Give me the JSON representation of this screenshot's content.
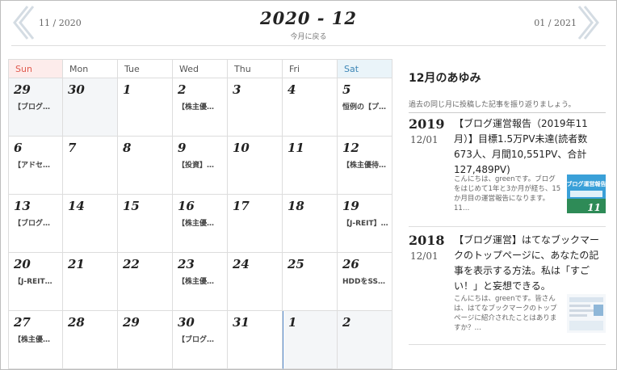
{
  "header": {
    "prev_month": "11 / 2020",
    "current_month": "2020 - 12",
    "today_link": "今月に戻る",
    "next_month": "01 / 2021"
  },
  "calendar": {
    "weekdays": [
      "Sun",
      "Mon",
      "Tue",
      "Wed",
      "Thu",
      "Fri",
      "Sat"
    ],
    "weeks": [
      [
        {
          "day": "29",
          "event": "【ブログ…",
          "other": true
        },
        {
          "day": "30",
          "event": "",
          "other": true
        },
        {
          "day": "1",
          "event": ""
        },
        {
          "day": "2",
          "event": "【株主優…"
        },
        {
          "day": "3",
          "event": ""
        },
        {
          "day": "4",
          "event": ""
        },
        {
          "day": "5",
          "event": "恒例の【プ…"
        }
      ],
      [
        {
          "day": "6",
          "event": "【アドセ…"
        },
        {
          "day": "7",
          "event": ""
        },
        {
          "day": "8",
          "event": ""
        },
        {
          "day": "9",
          "event": "【投資】…"
        },
        {
          "day": "10",
          "event": ""
        },
        {
          "day": "11",
          "event": ""
        },
        {
          "day": "12",
          "event": "【株主優待…"
        }
      ],
      [
        {
          "day": "13",
          "event": "【ブログ…"
        },
        {
          "day": "14",
          "event": ""
        },
        {
          "day": "15",
          "event": ""
        },
        {
          "day": "16",
          "event": "【株主優…"
        },
        {
          "day": "17",
          "event": ""
        },
        {
          "day": "18",
          "event": ""
        },
        {
          "day": "19",
          "event": "【J-REIT】…"
        }
      ],
      [
        {
          "day": "20",
          "event": "【J-REIT…"
        },
        {
          "day": "21",
          "event": ""
        },
        {
          "day": "22",
          "event": ""
        },
        {
          "day": "23",
          "event": "【株主優…"
        },
        {
          "day": "24",
          "event": ""
        },
        {
          "day": "25",
          "event": ""
        },
        {
          "day": "26",
          "event": "HDDをSS…"
        }
      ],
      [
        {
          "day": "27",
          "event": "【株主優…"
        },
        {
          "day": "28",
          "event": ""
        },
        {
          "day": "29",
          "event": ""
        },
        {
          "day": "30",
          "event": "【ブログ…"
        },
        {
          "day": "31",
          "event": ""
        },
        {
          "day": "1",
          "event": "",
          "other": true,
          "selected": true
        },
        {
          "day": "2",
          "event": "",
          "other": true
        }
      ]
    ]
  },
  "sidebar": {
    "title": "12月のあゆみ",
    "description": "過去の同じ月に投稿した記事を振り返りましょう。",
    "posts": [
      {
        "year": "2019",
        "date": "12/01",
        "title": "【ブログ運営報告（2019年11月）】目標1.5万PV未達(読者数673人、月間10,551PV、合計127,489PV)",
        "excerpt": "こんにちは、greenです。ブログをはじめて1年と3か月が経ち、15か月目の運営報告になります。11…",
        "thumb_text": "ブログ運営報告"
      },
      {
        "year": "2018",
        "date": "12/01",
        "title": "【ブログ運営】はてなブックマークのトップページに、あなたの記事を表示する方法。私は「すごい！」と妄想できる。",
        "excerpt": "こんにちは、greenです。皆さんは、はてなブックマークのトップページに紹介されたことはありますか？…"
      }
    ]
  },
  "colors": {
    "sunday_bg": "#fdeceb",
    "saturday_bg": "#eaf4f9",
    "thumb_blue": "#3aa0d8",
    "thumb_green": "#2e8b57"
  }
}
